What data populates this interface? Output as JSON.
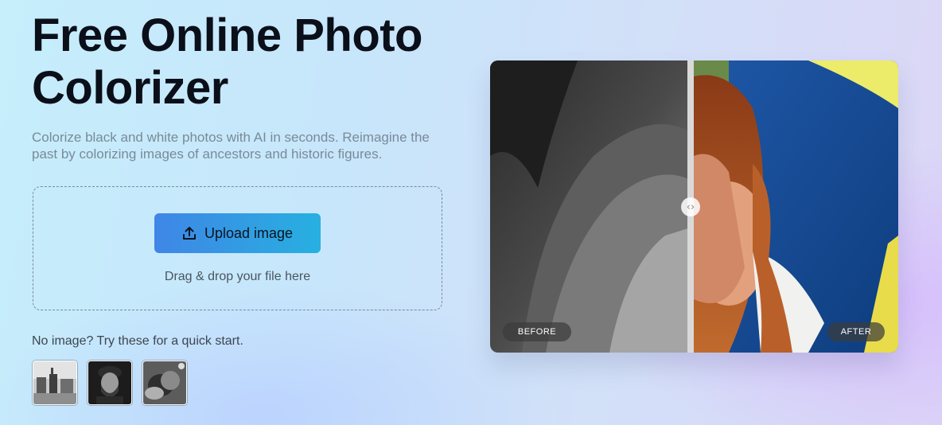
{
  "hero": {
    "title_line1": "Free Online Photo",
    "title_line2": "Colorizer",
    "subtitle": "Colorize black and white photos with AI in seconds. Reimagine the past by colorizing images of ancestors and historic figures."
  },
  "upload": {
    "button_label": "Upload image",
    "button_icon": "upload-icon",
    "drag_text": "Drag & drop your file here"
  },
  "samples": {
    "label": "No image? Try these for a quick start.",
    "thumbnails": [
      "sample-street-scene",
      "sample-man-portrait",
      "sample-animal-photo"
    ]
  },
  "comparison": {
    "before_label": "BEFORE",
    "after_label": "AFTER",
    "handle_icon": "split-arrows-icon",
    "split_fraction": 0.49
  },
  "colors": {
    "title": "#0b0f19",
    "subtitle": "#7a8a98",
    "button_start": "#3f86e6",
    "button_end": "#27b0e0"
  }
}
